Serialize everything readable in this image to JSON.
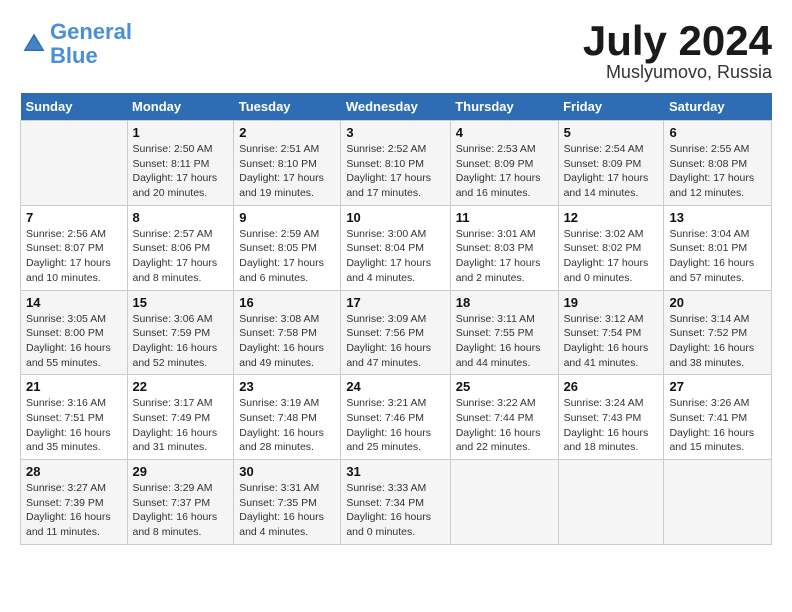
{
  "header": {
    "logo_line1": "General",
    "logo_line2": "Blue",
    "month": "July 2024",
    "location": "Muslyumovo, Russia"
  },
  "weekdays": [
    "Sunday",
    "Monday",
    "Tuesday",
    "Wednesday",
    "Thursday",
    "Friday",
    "Saturday"
  ],
  "weeks": [
    [
      {
        "day": "",
        "info": ""
      },
      {
        "day": "1",
        "info": "Sunrise: 2:50 AM\nSunset: 8:11 PM\nDaylight: 17 hours\nand 20 minutes."
      },
      {
        "day": "2",
        "info": "Sunrise: 2:51 AM\nSunset: 8:10 PM\nDaylight: 17 hours\nand 19 minutes."
      },
      {
        "day": "3",
        "info": "Sunrise: 2:52 AM\nSunset: 8:10 PM\nDaylight: 17 hours\nand 17 minutes."
      },
      {
        "day": "4",
        "info": "Sunrise: 2:53 AM\nSunset: 8:09 PM\nDaylight: 17 hours\nand 16 minutes."
      },
      {
        "day": "5",
        "info": "Sunrise: 2:54 AM\nSunset: 8:09 PM\nDaylight: 17 hours\nand 14 minutes."
      },
      {
        "day": "6",
        "info": "Sunrise: 2:55 AM\nSunset: 8:08 PM\nDaylight: 17 hours\nand 12 minutes."
      }
    ],
    [
      {
        "day": "7",
        "info": "Sunrise: 2:56 AM\nSunset: 8:07 PM\nDaylight: 17 hours\nand 10 minutes."
      },
      {
        "day": "8",
        "info": "Sunrise: 2:57 AM\nSunset: 8:06 PM\nDaylight: 17 hours\nand 8 minutes."
      },
      {
        "day": "9",
        "info": "Sunrise: 2:59 AM\nSunset: 8:05 PM\nDaylight: 17 hours\nand 6 minutes."
      },
      {
        "day": "10",
        "info": "Sunrise: 3:00 AM\nSunset: 8:04 PM\nDaylight: 17 hours\nand 4 minutes."
      },
      {
        "day": "11",
        "info": "Sunrise: 3:01 AM\nSunset: 8:03 PM\nDaylight: 17 hours\nand 2 minutes."
      },
      {
        "day": "12",
        "info": "Sunrise: 3:02 AM\nSunset: 8:02 PM\nDaylight: 17 hours\nand 0 minutes."
      },
      {
        "day": "13",
        "info": "Sunrise: 3:04 AM\nSunset: 8:01 PM\nDaylight: 16 hours\nand 57 minutes."
      }
    ],
    [
      {
        "day": "14",
        "info": "Sunrise: 3:05 AM\nSunset: 8:00 PM\nDaylight: 16 hours\nand 55 minutes."
      },
      {
        "day": "15",
        "info": "Sunrise: 3:06 AM\nSunset: 7:59 PM\nDaylight: 16 hours\nand 52 minutes."
      },
      {
        "day": "16",
        "info": "Sunrise: 3:08 AM\nSunset: 7:58 PM\nDaylight: 16 hours\nand 49 minutes."
      },
      {
        "day": "17",
        "info": "Sunrise: 3:09 AM\nSunset: 7:56 PM\nDaylight: 16 hours\nand 47 minutes."
      },
      {
        "day": "18",
        "info": "Sunrise: 3:11 AM\nSunset: 7:55 PM\nDaylight: 16 hours\nand 44 minutes."
      },
      {
        "day": "19",
        "info": "Sunrise: 3:12 AM\nSunset: 7:54 PM\nDaylight: 16 hours\nand 41 minutes."
      },
      {
        "day": "20",
        "info": "Sunrise: 3:14 AM\nSunset: 7:52 PM\nDaylight: 16 hours\nand 38 minutes."
      }
    ],
    [
      {
        "day": "21",
        "info": "Sunrise: 3:16 AM\nSunset: 7:51 PM\nDaylight: 16 hours\nand 35 minutes."
      },
      {
        "day": "22",
        "info": "Sunrise: 3:17 AM\nSunset: 7:49 PM\nDaylight: 16 hours\nand 31 minutes."
      },
      {
        "day": "23",
        "info": "Sunrise: 3:19 AM\nSunset: 7:48 PM\nDaylight: 16 hours\nand 28 minutes."
      },
      {
        "day": "24",
        "info": "Sunrise: 3:21 AM\nSunset: 7:46 PM\nDaylight: 16 hours\nand 25 minutes."
      },
      {
        "day": "25",
        "info": "Sunrise: 3:22 AM\nSunset: 7:44 PM\nDaylight: 16 hours\nand 22 minutes."
      },
      {
        "day": "26",
        "info": "Sunrise: 3:24 AM\nSunset: 7:43 PM\nDaylight: 16 hours\nand 18 minutes."
      },
      {
        "day": "27",
        "info": "Sunrise: 3:26 AM\nSunset: 7:41 PM\nDaylight: 16 hours\nand 15 minutes."
      }
    ],
    [
      {
        "day": "28",
        "info": "Sunrise: 3:27 AM\nSunset: 7:39 PM\nDaylight: 16 hours\nand 11 minutes."
      },
      {
        "day": "29",
        "info": "Sunrise: 3:29 AM\nSunset: 7:37 PM\nDaylight: 16 hours\nand 8 minutes."
      },
      {
        "day": "30",
        "info": "Sunrise: 3:31 AM\nSunset: 7:35 PM\nDaylight: 16 hours\nand 4 minutes."
      },
      {
        "day": "31",
        "info": "Sunrise: 3:33 AM\nSunset: 7:34 PM\nDaylight: 16 hours\nand 0 minutes."
      },
      {
        "day": "",
        "info": ""
      },
      {
        "day": "",
        "info": ""
      },
      {
        "day": "",
        "info": ""
      }
    ]
  ]
}
